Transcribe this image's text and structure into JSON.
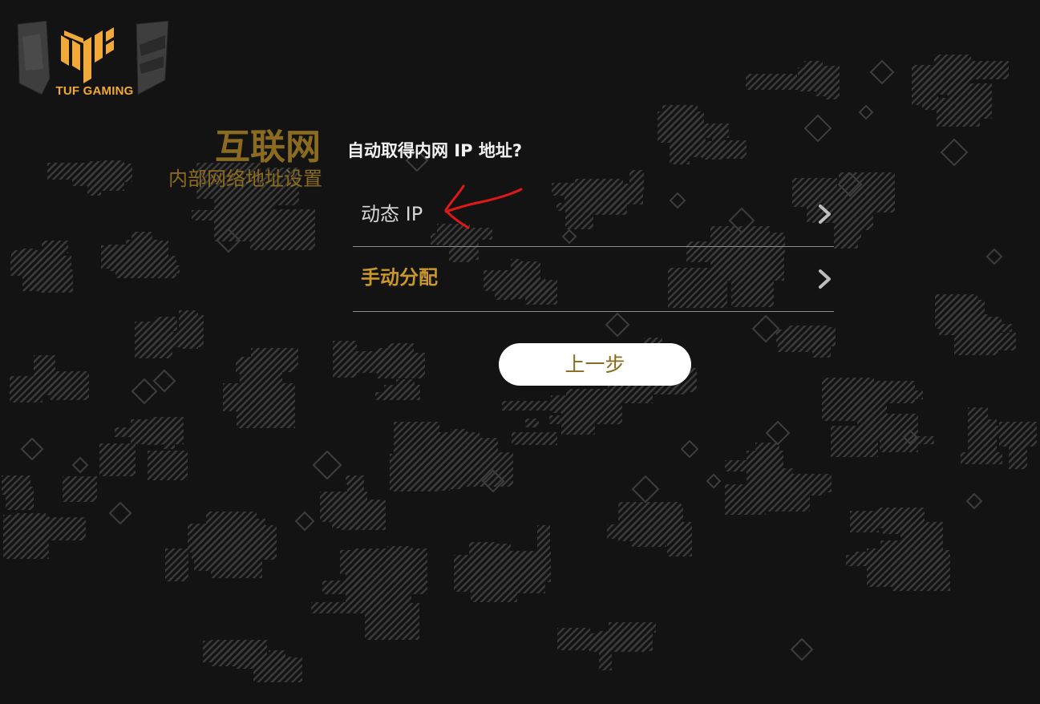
{
  "brand": {
    "name": "TUF GAMING",
    "accent": "#f1a93a"
  },
  "sidebar": {
    "title": "互联网",
    "subtitle": "内部网络地址设置"
  },
  "main": {
    "question": "自动取得内网 IP 地址?",
    "options": [
      {
        "label": "动态 IP",
        "icon": "chevron-right-icon"
      },
      {
        "label": "手动分配",
        "icon": "chevron-right-icon"
      }
    ],
    "back_label": "上一步"
  },
  "colors": {
    "background": "#131313",
    "gold": "#8a6b1f",
    "selected_option": "#c9972c",
    "annotation": "#e01818"
  }
}
